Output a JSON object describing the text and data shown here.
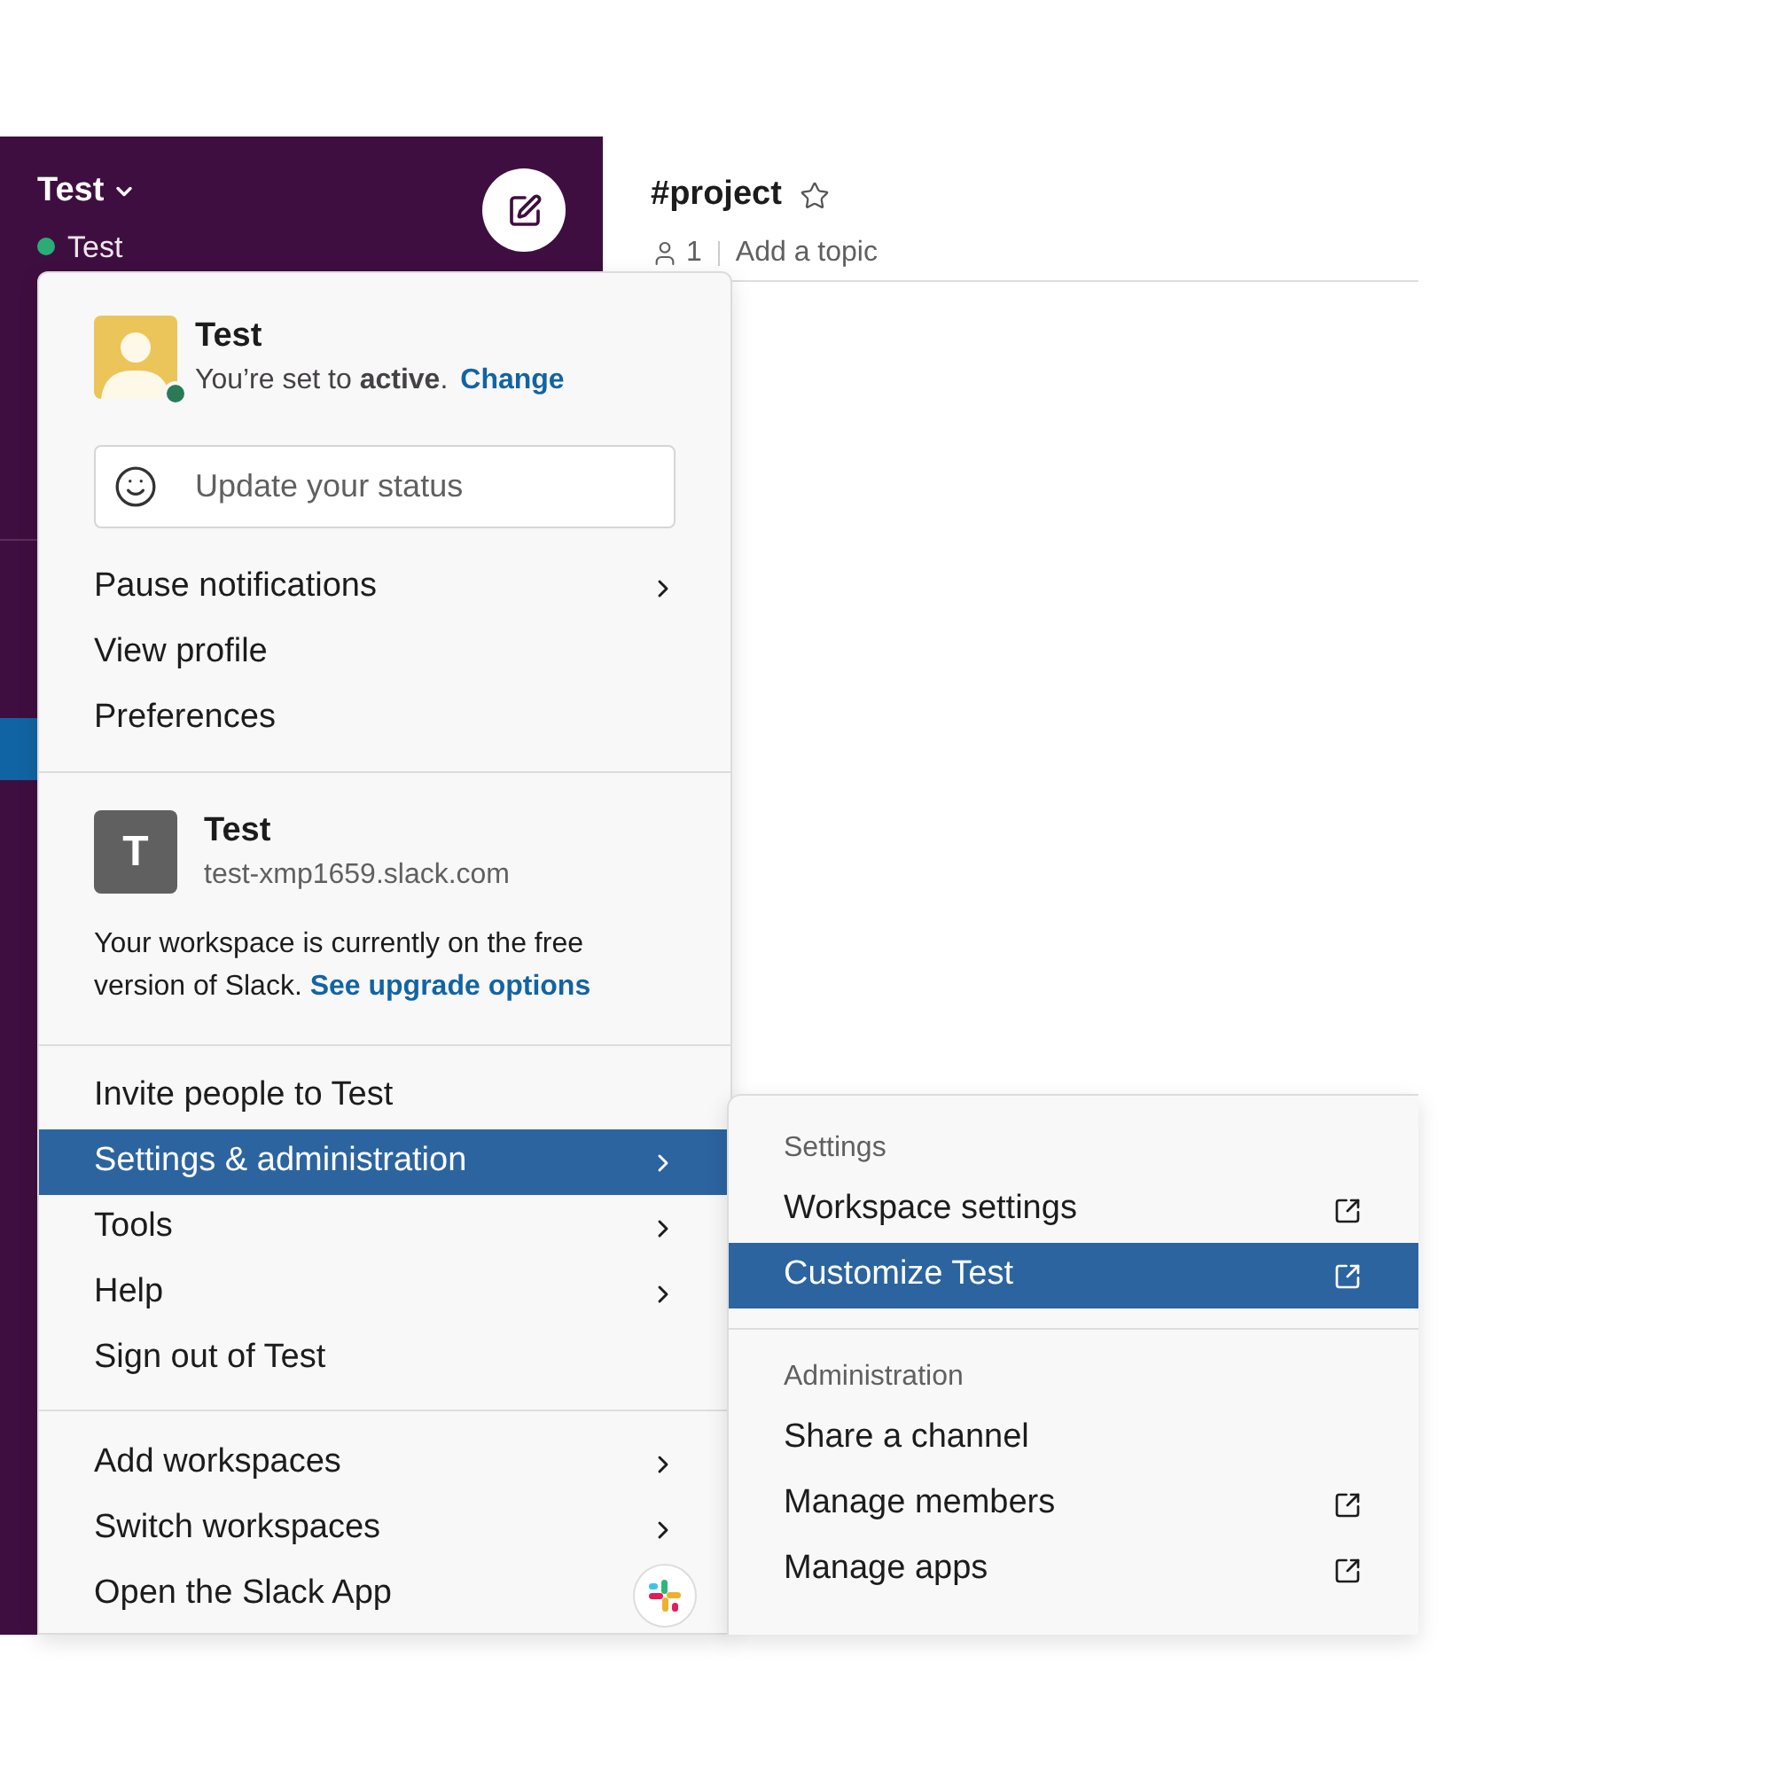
{
  "workspace": {
    "name": "Test",
    "status_label": "Test"
  },
  "channel": {
    "name": "#project",
    "members": "1",
    "topic": "Add a topic"
  },
  "menu": {
    "user": {
      "name": "Test",
      "status_text": "You’re set to **active**.",
      "change_link": "Change",
      "status_field": {
        "placeholder": "Update your status"
      }
    },
    "user_items": [
      {
        "label": "Pause notifications",
        "kind": "submenu",
        "selected": false
      },
      {
        "label": "View profile",
        "kind": "plain",
        "selected": false
      },
      {
        "label": "Preferences",
        "kind": "plain",
        "selected": false
      }
    ],
    "team": {
      "initial": "T",
      "name": "Test",
      "domain": "test-xmp1659.slack.com",
      "notice": "Your workspace is currently on the free version of Slack.",
      "upgrade_link": "See upgrade options"
    },
    "team_items": [
      {
        "label": "Invite people to Test",
        "kind": "plain",
        "selected": false
      },
      {
        "label": "Settings & administration",
        "kind": "submenu",
        "selected": true
      },
      {
        "label": "Tools",
        "kind": "submenu",
        "selected": false
      },
      {
        "label": "Help",
        "kind": "submenu",
        "selected": false
      },
      {
        "label": "Sign out of Test",
        "kind": "plain",
        "selected": false
      }
    ],
    "app_items": [
      {
        "label": "Add workspaces",
        "kind": "submenu",
        "selected": false
      },
      {
        "label": "Switch workspaces",
        "kind": "submenu",
        "selected": false
      },
      {
        "label": "Open the Slack App",
        "kind": "app",
        "selected": false
      }
    ]
  },
  "submenu": [
    {
      "heading": "Settings",
      "items": [
        {
          "label": "Workspace settings",
          "kind": "external",
          "selected": false
        },
        {
          "label": "Customize Test",
          "kind": "external",
          "selected": true
        }
      ]
    },
    {
      "heading": "Administration",
      "items": [
        {
          "label": "Share a channel",
          "kind": "plain",
          "selected": false
        },
        {
          "label": "Manage members",
          "kind": "external",
          "selected": false
        },
        {
          "label": "Manage apps",
          "kind": "external",
          "selected": false
        }
      ]
    }
  ]
}
